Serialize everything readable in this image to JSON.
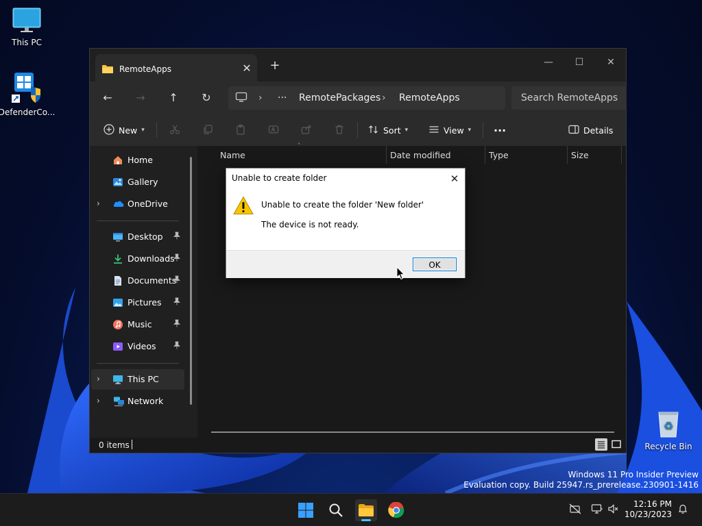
{
  "desktop": {
    "icons": [
      {
        "label": "This PC"
      },
      {
        "label": "DefenderCo..."
      },
      {
        "label": "Recycle Bin"
      }
    ],
    "watermark": {
      "line1": "Windows 11 Pro Insider Preview",
      "line2": "Evaluation copy. Build 25947.rs_prerelease.230901-1416"
    }
  },
  "explorer": {
    "tab": {
      "title": "RemoteApps",
      "close": "✕"
    },
    "new_tab": "+",
    "window_controls": {
      "minimize": "—",
      "maximize": "☐",
      "close": "✕"
    },
    "nav_buttons": {
      "back": "←",
      "forward": "→",
      "up": "↑",
      "refresh": "↻"
    },
    "breadcrumb": {
      "overflow": "···",
      "segments": [
        "RemotePackages",
        "RemoteApps"
      ],
      "separator": "›"
    },
    "search_placeholder": "Search RemoteApps",
    "toolbar": {
      "new_label": "New",
      "sort_label": "Sort",
      "view_label": "View",
      "more_label": "···",
      "details_label": "Details"
    },
    "sidebar": {
      "groups": [
        [
          {
            "label": "Home",
            "icon": "home-icon"
          },
          {
            "label": "Gallery",
            "icon": "gallery-icon"
          },
          {
            "label": "OneDrive",
            "icon": "onedrive-icon",
            "expandable": true
          }
        ],
        [
          {
            "label": "Desktop",
            "icon": "desktop-icon",
            "pinned": true
          },
          {
            "label": "Downloads",
            "icon": "downloads-icon",
            "pinned": true
          },
          {
            "label": "Documents",
            "icon": "documents-icon",
            "pinned": true
          },
          {
            "label": "Pictures",
            "icon": "pictures-icon",
            "pinned": true
          },
          {
            "label": "Music",
            "icon": "music-icon",
            "pinned": true
          },
          {
            "label": "Videos",
            "icon": "videos-icon",
            "pinned": true
          }
        ],
        [
          {
            "label": "This PC",
            "icon": "this-pc-icon",
            "expandable": true,
            "selected": true
          },
          {
            "label": "Network",
            "icon": "network-icon",
            "expandable": true
          }
        ]
      ]
    },
    "columns": [
      "Name",
      "Date modified",
      "Type",
      "Size"
    ],
    "status": {
      "item_count": "0 items"
    }
  },
  "dialog": {
    "title": "Unable to create folder",
    "close": "✕",
    "message": "Unable to create the folder 'New folder'",
    "detail": "The device is not ready.",
    "ok_label": "OK"
  },
  "taskbar": {
    "time": "12:16 PM",
    "date": "10/23/2023"
  },
  "colors": {
    "accent": "#4cc2ff",
    "window_bg": "#191919",
    "toolbar_bg": "#2b2b2b",
    "folder_yellow": "#f6c244",
    "warning_yellow": "#f7c600"
  }
}
